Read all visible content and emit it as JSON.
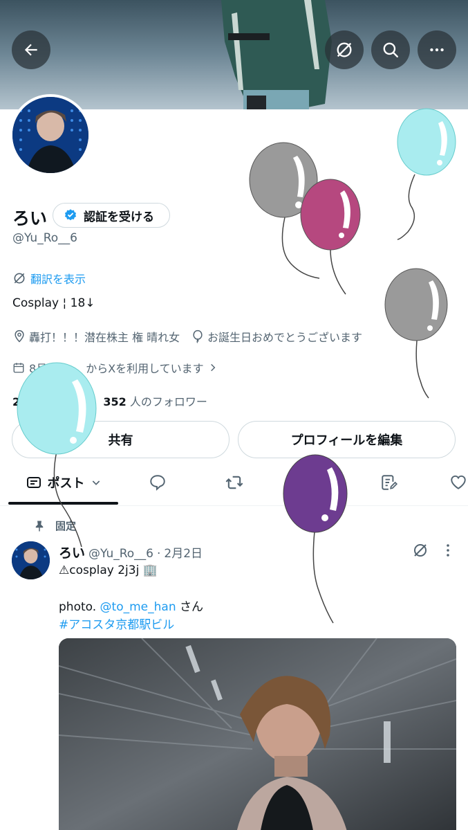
{
  "header": {
    "back_icon": "arrow-left-icon",
    "actions": [
      "translate-icon",
      "search-icon",
      "more-icon"
    ]
  },
  "profile": {
    "name": "ろい",
    "verify_label": "認証を受ける",
    "handle": "@Yu_Ro__6",
    "translate_label": "翻訳を表示",
    "bio": "Cosplay ¦ 18↓",
    "location": "轟打！！！潜在株主 権 晴れ女",
    "birthday": "お誕生日おめでとうございます",
    "joined_prefix": "8月",
    "joined_suffix": "からXを利用しています",
    "following_count": "2",
    "followers_count": "352",
    "followers_label": "人のフォロワー",
    "share_label": "共有",
    "edit_label": "プロフィールを編集"
  },
  "tabs": [
    {
      "label": "ポスト",
      "icon": "posts-icon",
      "active": true
    },
    {
      "icon": "reply-icon"
    },
    {
      "icon": "repost-icon"
    },
    {
      "icon": "media-icon"
    },
    {
      "icon": "articles-icon"
    },
    {
      "icon": "like-icon"
    }
  ],
  "post": {
    "pinned_label": "固定",
    "name": "ろい",
    "handle": "@Yu_Ro__6",
    "dot": "·",
    "date": "2月2日",
    "line1": "⚠︎cosplay 2j3j 🏢",
    "photo_prefix": "photo.",
    "mention": "@to_me_han",
    "mention_suffix": "さん",
    "hashtag": "#アコスタ京都駅ビル"
  },
  "colors": {
    "accent": "#1d9bf0",
    "balloon_gray": "#9a9a9a",
    "balloon_pink": "#b6487f",
    "balloon_cyan": "#a9ecef",
    "balloon_purple": "#6d3c90"
  }
}
